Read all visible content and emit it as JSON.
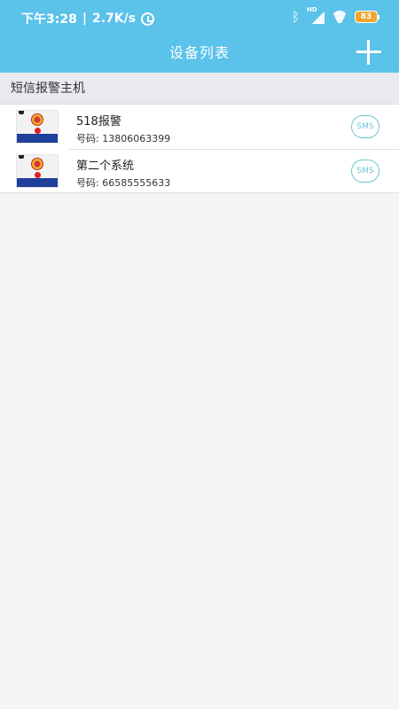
{
  "status_bar": {
    "time": "下午3:28",
    "speed": "2.7K/s",
    "hd_label": "HD",
    "battery": "83"
  },
  "header": {
    "title": "设备列表"
  },
  "section": {
    "title": "短信报警主机"
  },
  "devices": [
    {
      "name": "518报警",
      "number": "号码: 13806063399",
      "action": "SMS"
    },
    {
      "name": "第二个系统",
      "number": "号码: 66585555633",
      "action": "SMS"
    }
  ],
  "colors": {
    "accent": "#5bc2ea",
    "sms": "#6dc6cf"
  }
}
